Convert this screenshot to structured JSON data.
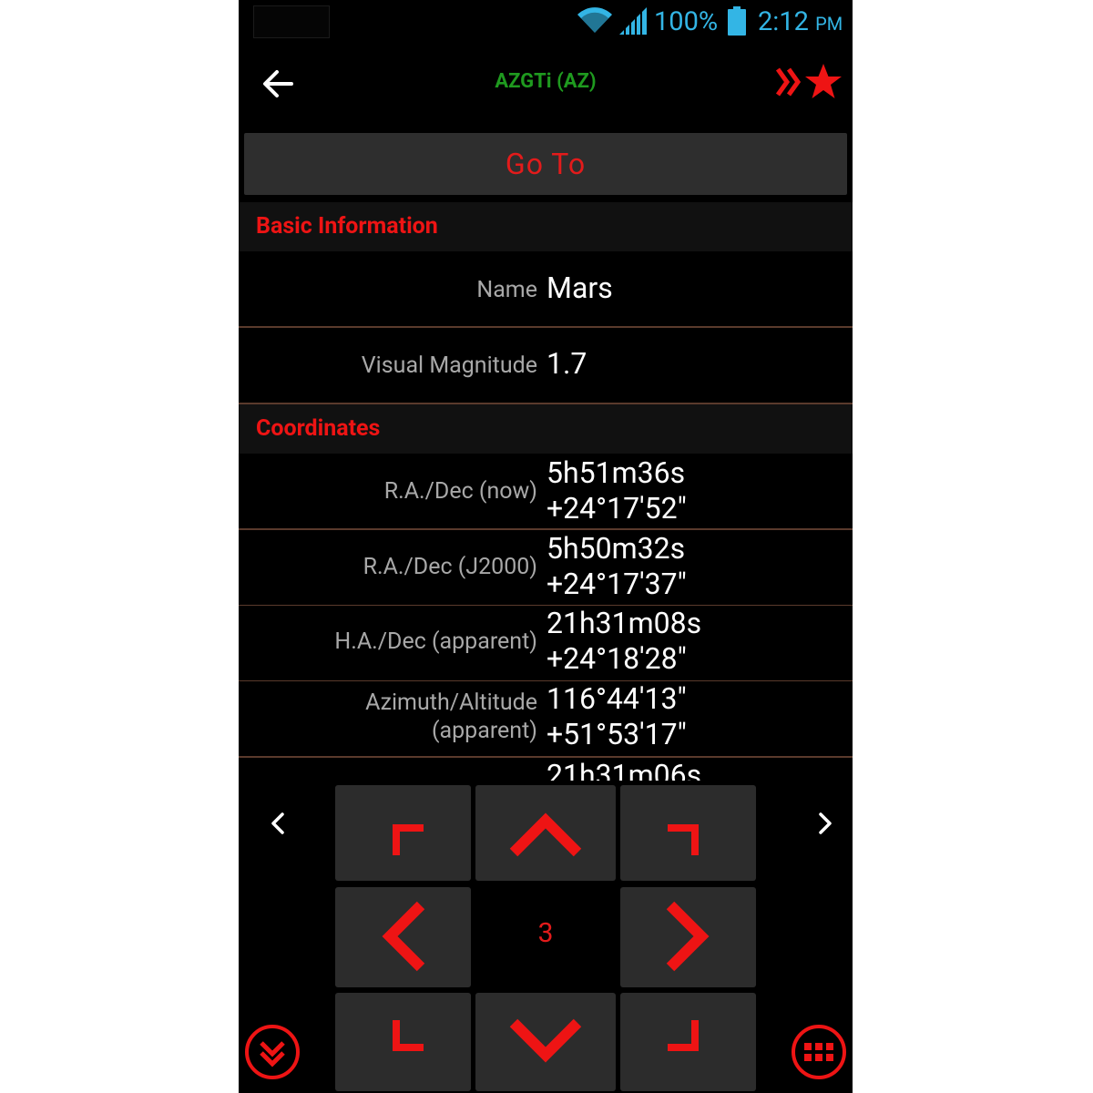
{
  "status_bar": {
    "battery_percent": "100%",
    "time": "2:12",
    "ampm": "PM",
    "accent_color": "#33b5e5",
    "icons": [
      "wifi-icon",
      "signal-icon",
      "battery-icon"
    ]
  },
  "action_bar": {
    "title": "AZGTi (AZ)",
    "title_color": "#1f9a1f",
    "icons": [
      "back-arrow-icon",
      "double-chevron-icon",
      "star-icon"
    ]
  },
  "goto_button": {
    "label": "Go To"
  },
  "sections": {
    "basic": {
      "title": "Basic Information"
    },
    "coordinates": {
      "title": "Coordinates"
    }
  },
  "basic_info": [
    {
      "label": "Name",
      "value": "Mars"
    },
    {
      "label": "Visual Magnitude",
      "value": "1.7"
    }
  ],
  "coordinates": [
    {
      "label": "R.A./Dec (now)",
      "value1": "5h51m36s",
      "value2": "+24°17′52″"
    },
    {
      "label": "R.A./Dec (J2000)",
      "value1": "5h50m32s",
      "value2": "+24°17′37″"
    },
    {
      "label": "H.A./Dec (apparent)",
      "value1": "21h31m08s",
      "value2": "+24°18′28″"
    },
    {
      "label1": "Azimuth/Altitude",
      "label2": "(apparent)",
      "value1": "116°44′13″",
      "value2": "+51°53′17″"
    },
    {
      "value1": "21h31m06s"
    }
  ],
  "controls": {
    "speed": "3",
    "accent_color": "#e31b1b",
    "icons": [
      "prev-icon",
      "next-icon",
      "collapse-icon",
      "keypad-icon",
      "up-left-icon",
      "up-icon",
      "up-right-icon",
      "left-icon",
      "right-icon",
      "down-left-icon",
      "down-icon",
      "down-right-icon"
    ]
  }
}
